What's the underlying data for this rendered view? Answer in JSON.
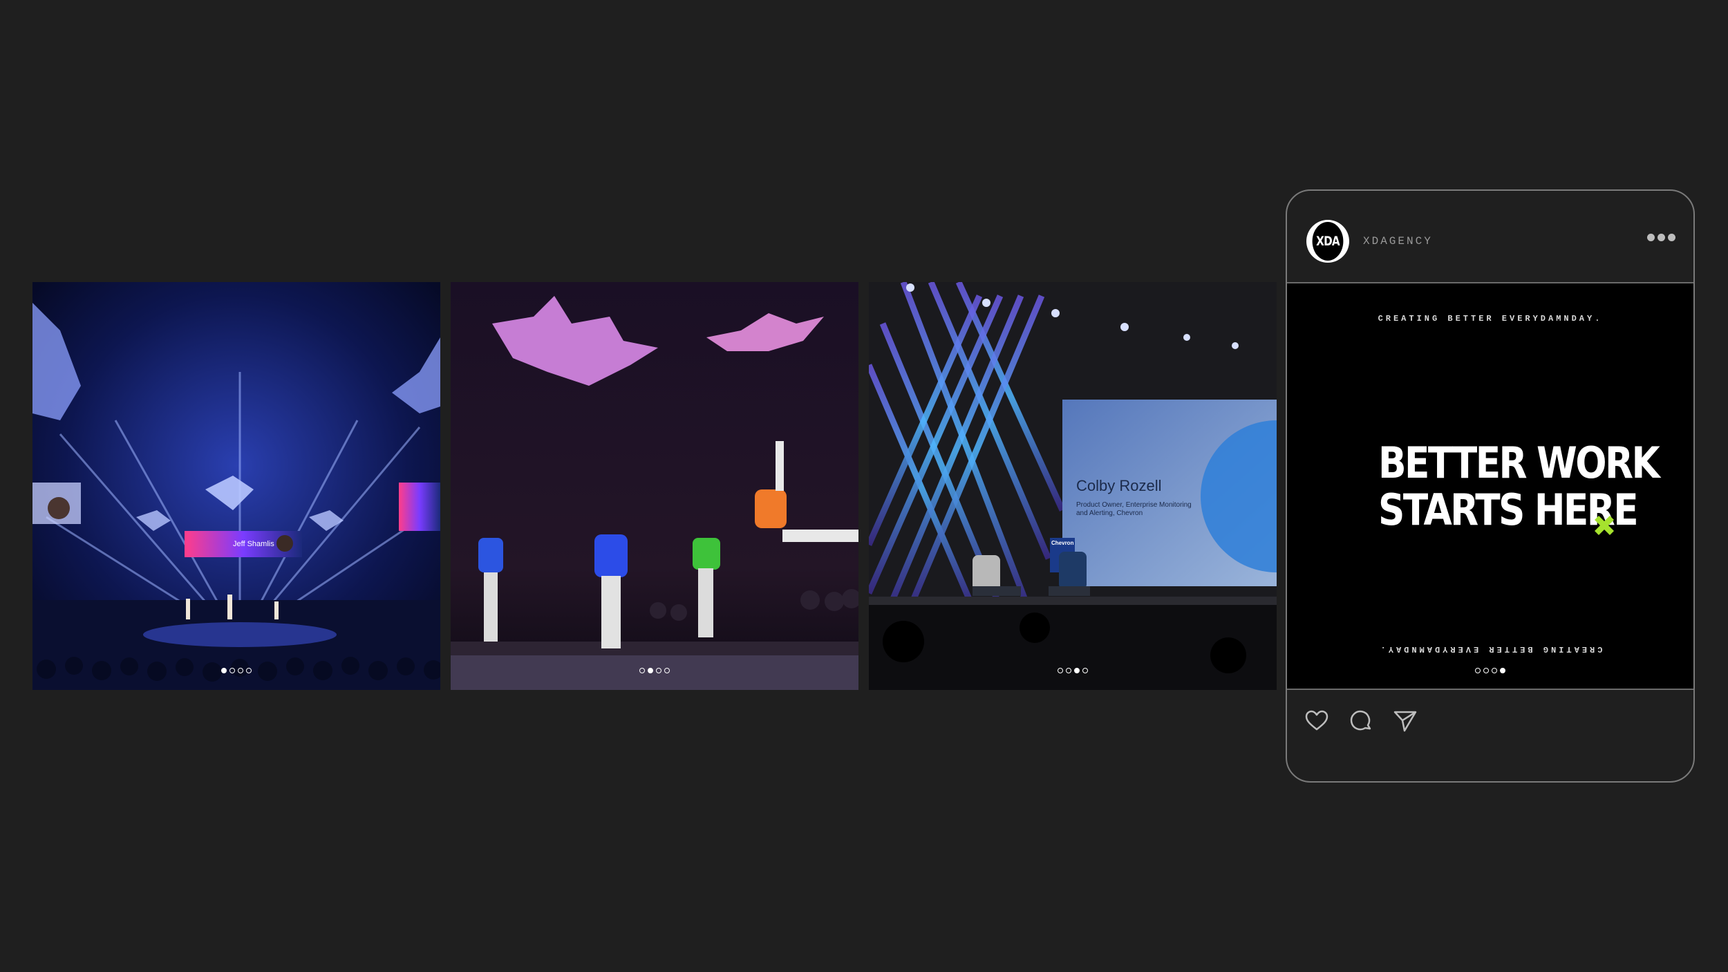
{
  "carousel": [
    {
      "dots": 4,
      "active": 0
    },
    {
      "dots": 4,
      "active": 1
    },
    {
      "dots": 4,
      "active": 2
    }
  ],
  "slide_text": {
    "screen_name": "Jeff Shamlis",
    "speaker_name": "Colby Rozell",
    "speaker_title": "Product Owner, Enterprise Monitoring",
    "speaker_title_2": "and Alerting, Chevron",
    "screen_brand": "Chevron"
  },
  "post": {
    "avatar_text": "XDA",
    "username": "XDAGENCY",
    "tagline": "CREATING BETTER EVERYDAMNDAY.",
    "headline_line1": "BETTER WORK",
    "headline_line2": "STARTS HERE",
    "dots": 4,
    "active": 3
  },
  "colors": {
    "background": "#1f1f1f",
    "accent": "#a6e22e"
  },
  "icons": [
    "heart-icon",
    "comment-icon",
    "send-icon",
    "more-icon"
  ]
}
